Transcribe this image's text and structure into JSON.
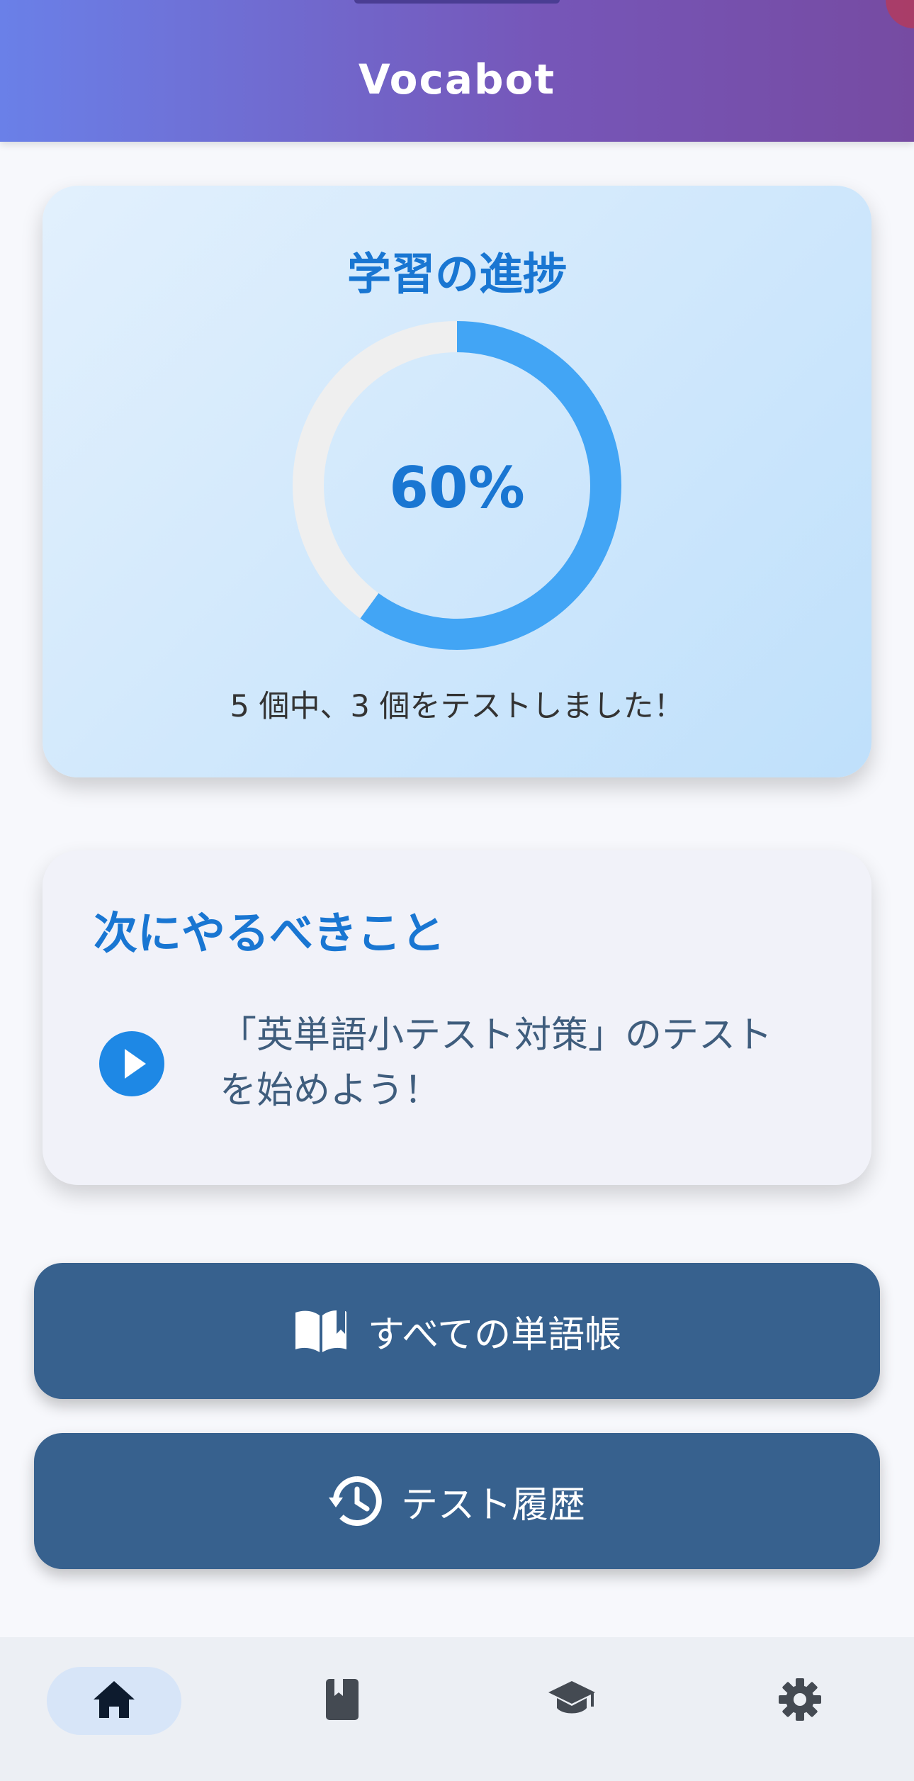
{
  "app": {
    "title": "Vocabot"
  },
  "progress": {
    "title": "学習の進捗",
    "percent_label": "60%",
    "fraction": 0.6,
    "caption": "5 個中、3 個をテストしました！",
    "ring_color": "#42a5f5",
    "track_color": "#efefef"
  },
  "next_action": {
    "title": "次にやるべきこと",
    "line1": "「英単語小テスト対策」のテスト",
    "line2": "を始めよう！",
    "icon": "play-circle-icon"
  },
  "buttons": {
    "wordbooks_label": "すべての単語帳",
    "wordbooks_icon": "open-book-icon",
    "history_label": "テスト履歴",
    "history_icon": "history-icon"
  },
  "bottom_nav": {
    "items": [
      {
        "icon": "home-icon",
        "active": true
      },
      {
        "icon": "book-icon",
        "active": false
      },
      {
        "icon": "graduation-cap-icon",
        "active": false
      },
      {
        "icon": "gear-icon",
        "active": false
      }
    ]
  },
  "colors": {
    "header_start": "#667eea",
    "header_end": "#764ba2",
    "accent": "#1976d2",
    "button": "#37618e"
  }
}
